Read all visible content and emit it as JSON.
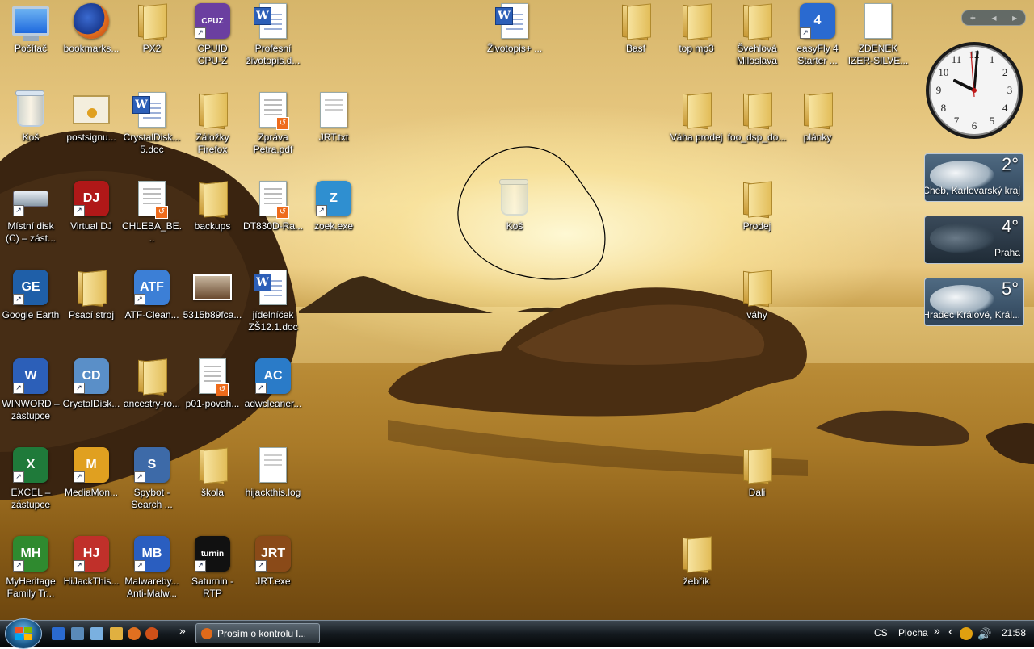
{
  "desktop": {
    "icons": [
      {
        "label": "Počítač",
        "type": "computer"
      },
      {
        "label": "bookmarks...",
        "type": "firefox"
      },
      {
        "label": "PX2",
        "type": "folder"
      },
      {
        "label": "CPUID\nCPU-Z",
        "type": "app",
        "color": "#6b3fa0",
        "text": "CPUZ"
      },
      {
        "label": "Profesní\nživotopis.d...",
        "type": "word"
      },
      {
        "label": "Koš",
        "type": "bin"
      },
      {
        "label": "postsignu...",
        "type": "certificate"
      },
      {
        "label": "CrystalDisk...\n5.doc",
        "type": "word"
      },
      {
        "label": "Záložky\nFirefox",
        "type": "folder"
      },
      {
        "label": "Zpráva\nPetra.pdf",
        "type": "pdf"
      },
      {
        "label": "JRT.txt",
        "type": "text"
      },
      {
        "label": "Místní disk\n(C) – zást...",
        "type": "drive"
      },
      {
        "label": "Virtual DJ",
        "type": "app",
        "color": "#b01818",
        "text": "DJ"
      },
      {
        "label": "CHLEBA_BE...",
        "type": "pdf"
      },
      {
        "label": "backups",
        "type": "folder"
      },
      {
        "label": "DT830D-Ra...",
        "type": "pdf"
      },
      {
        "label": "zoek.exe",
        "type": "app",
        "color": "#2f8fd0",
        "text": "Z"
      },
      {
        "label": "Google Earth",
        "type": "app",
        "color": "#1f5fa8",
        "text": "GE"
      },
      {
        "label": "Psací stroj",
        "type": "folder"
      },
      {
        "label": "ATF-Clean...",
        "type": "app",
        "color": "#3c7fd6",
        "text": "ATF"
      },
      {
        "label": "5315b89fca...",
        "type": "photo"
      },
      {
        "label": "jídelníček\nZŠ12.1.doc",
        "type": "word"
      },
      {
        "label": "WINWORD –\nzástupce",
        "type": "app",
        "color": "#2c5fb8",
        "text": "W"
      },
      {
        "label": "CrystalDisk...",
        "type": "app",
        "color": "#5a8fc8",
        "text": "CD"
      },
      {
        "label": "ancestry-ro...",
        "type": "folder"
      },
      {
        "label": "p01-povah...",
        "type": "pdf"
      },
      {
        "label": "adwcleaner...",
        "type": "app",
        "color": "#2a7bc8",
        "text": "AC"
      },
      {
        "label": "EXCEL –\nzástupce",
        "type": "app",
        "color": "#1f7a3a",
        "text": "X"
      },
      {
        "label": "MediaMon...",
        "type": "app",
        "color": "#e0a020",
        "text": "M"
      },
      {
        "label": "Spybot -\nSearch ...",
        "type": "app",
        "color": "#3d6aa8",
        "text": "S"
      },
      {
        "label": "škola",
        "type": "folder"
      },
      {
        "label": "hijackthis.log",
        "type": "text"
      },
      {
        "label": "MyHeritage\nFamily Tr...",
        "type": "app",
        "color": "#2f8a2f",
        "text": "MH"
      },
      {
        "label": "HiJackThis...",
        "type": "app",
        "color": "#c0302a",
        "text": "HJ"
      },
      {
        "label": "Malwareby...\nAnti-Malw...",
        "type": "app",
        "color": "#2a5ec0",
        "text": "MB"
      },
      {
        "label": "Saturnin -\nRTP",
        "type": "app",
        "color": "#111111",
        "text": "turnin"
      },
      {
        "label": "JRT.exe",
        "type": "app",
        "color": "#8a4a18",
        "text": "JRT"
      },
      {
        "label": "Koš",
        "type": "bin-ghost"
      },
      {
        "label": "Životopis+ ...",
        "type": "word"
      },
      {
        "label": "Basf",
        "type": "folder"
      },
      {
        "label": "top mp3",
        "type": "folder"
      },
      {
        "label": "Švehlová\nMiloslava",
        "type": "folder"
      },
      {
        "label": "easyFly 4\nStarter ...",
        "type": "app",
        "color": "#2a6ad0",
        "text": "4"
      },
      {
        "label": "ZDENEK\nIZER-SILVE...",
        "type": "blank"
      },
      {
        "label": "Váha prodej",
        "type": "folder"
      },
      {
        "label": "foo_dsp_do...",
        "type": "folder"
      },
      {
        "label": "plánky",
        "type": "folder"
      },
      {
        "label": "Prodej",
        "type": "folder"
      },
      {
        "label": "váhy",
        "type": "folder"
      },
      {
        "label": "Dali",
        "type": "folder"
      },
      {
        "label": "žebřík",
        "type": "folder"
      }
    ]
  },
  "gadgets": {
    "toolbar": {
      "add": "+",
      "prev": "◂",
      "next": "▸"
    },
    "clock": {
      "numbers": [
        "12",
        "1",
        "2",
        "3",
        "4",
        "5",
        "6",
        "7",
        "8",
        "9",
        "10",
        "11"
      ]
    },
    "weather": [
      {
        "temp": "2°",
        "city": "Cheb, Karlovarský kraj"
      },
      {
        "temp": "4°",
        "city": "Praha"
      },
      {
        "temp": "5°",
        "city": "Hradec Králové, Král..."
      }
    ]
  },
  "taskbar": {
    "quicklaunch_more": "»",
    "window_button": "Prosím o kontrolu l...",
    "language": "CS",
    "desktop_toolbar": "Plocha",
    "desktop_more": "»",
    "tray_expand": "‹",
    "time": "21:58"
  },
  "colors": {
    "taskbar": "#141a1f",
    "accent": "#2c5fb8"
  }
}
